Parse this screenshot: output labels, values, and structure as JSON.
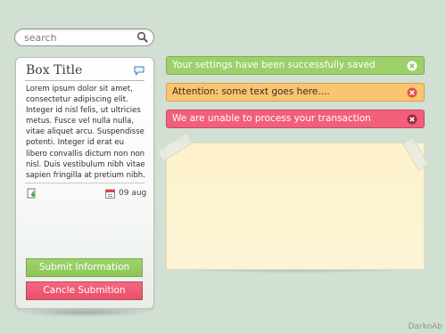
{
  "search": {
    "placeholder": "search",
    "icon": "search-icon"
  },
  "box": {
    "title": "Box Title",
    "body": "Lorem ipsum dolor sit amet, consectetur adipiscing elit. Integer id nisl felis, ut ultricies metus. Fusce vel nulla nulla, vitae aliquet arcu. Suspendisse potenti. Integer id erat eu libero convallis dictum non non nisl. Duis vestibulum nibh vitae sapien fringilla at pretium nibh.",
    "date": "09 aug",
    "submit_label": "Submit Information",
    "cancel_label": "Cancle Submition"
  },
  "alerts": [
    {
      "type": "success",
      "text": "Your settings have been successfully saved",
      "color": "#9dd06a"
    },
    {
      "type": "warning",
      "text": "Attention: some text goes here....",
      "color": "#fbc471"
    },
    {
      "type": "error",
      "text": "We are unable to process your transaction",
      "color": "#f25f7b"
    }
  ],
  "credit": "DarkoAb"
}
